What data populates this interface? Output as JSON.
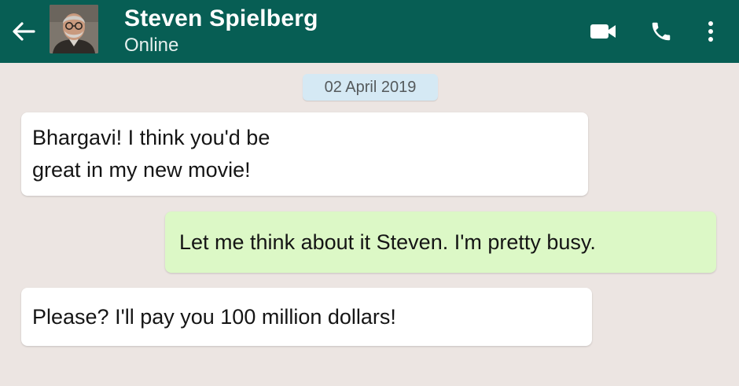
{
  "header": {
    "contact_name": "Steven Spielberg",
    "status": "Online",
    "colors": {
      "bar": "#075e54",
      "text": "#ffffff"
    },
    "icons": [
      "back-arrow-icon",
      "video-call-icon",
      "phone-call-icon",
      "more-options-icon"
    ]
  },
  "chat": {
    "date_label": "02 April 2019",
    "messages": [
      {
        "direction": "incoming",
        "lines": [
          "Bhargavi! I think you'd be",
          "great in my new movie!"
        ]
      },
      {
        "direction": "outgoing",
        "text": "Let me think about it Steven. I'm pretty busy."
      },
      {
        "direction": "incoming",
        "text": "Please? I'll pay you 100 million dollars!"
      }
    ],
    "colors": {
      "background": "#ece5e2",
      "incoming": "#ffffff",
      "outgoing": "#dcf8c6",
      "date_chip": "#d5e9f4"
    }
  }
}
